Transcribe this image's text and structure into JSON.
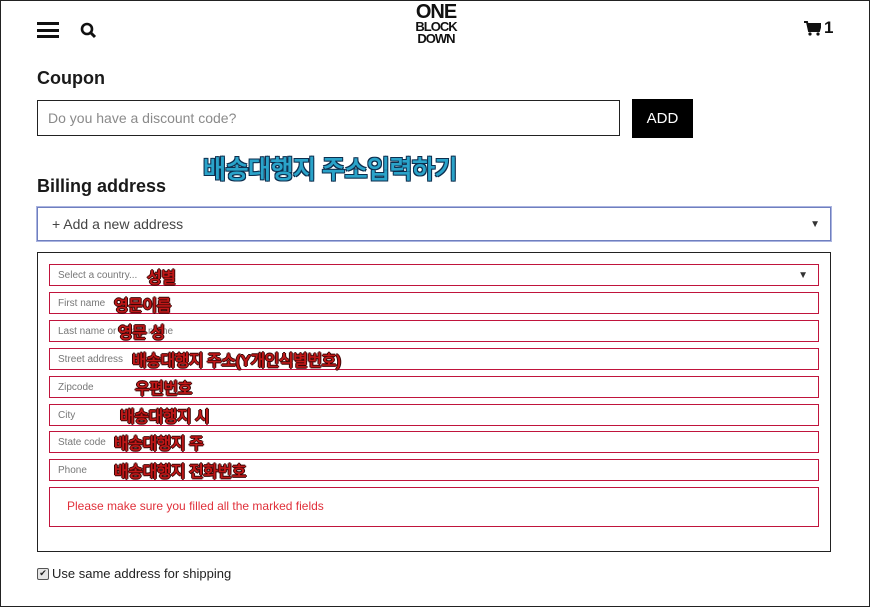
{
  "header": {
    "logo_lines": [
      "ONE",
      "BLOCK",
      "DOWN"
    ],
    "cart_count": "1",
    "icons": [
      "menu-icon",
      "search-icon",
      "cart-icon"
    ]
  },
  "coupon": {
    "title": "Coupon",
    "placeholder": "Do you have a discount code?",
    "add_label": "ADD"
  },
  "billing": {
    "title": "Billing address",
    "annotation": "배송대행지 주소입력하기",
    "address_select": "+ Add a new address",
    "fields": [
      {
        "placeholder": "Select a country...",
        "annotation": "성별"
      },
      {
        "placeholder": "First name",
        "annotation": "영문이름"
      },
      {
        "placeholder": "Last name or family name",
        "annotation": "영문 성"
      },
      {
        "placeholder": "Street address",
        "annotation": "배송대행지 주소(Y개인식별번호)"
      },
      {
        "placeholder": "Zipcode",
        "annotation": "우편번호"
      },
      {
        "placeholder": "City",
        "annotation": "배송대행지 시"
      },
      {
        "placeholder": "State code",
        "annotation": "배송대행지 주"
      },
      {
        "placeholder": "Phone",
        "annotation": "배송대행지 전화번호"
      }
    ],
    "error": "Please make sure you filled all the marked fields",
    "same_address_label": "Use same address for shipping",
    "same_address_checked": true
  },
  "colors": {
    "error_border": "#c0143c",
    "error_text": "#e0303a",
    "annotation_red": "#c01818",
    "annotation_blue": "#2aa3c9"
  }
}
